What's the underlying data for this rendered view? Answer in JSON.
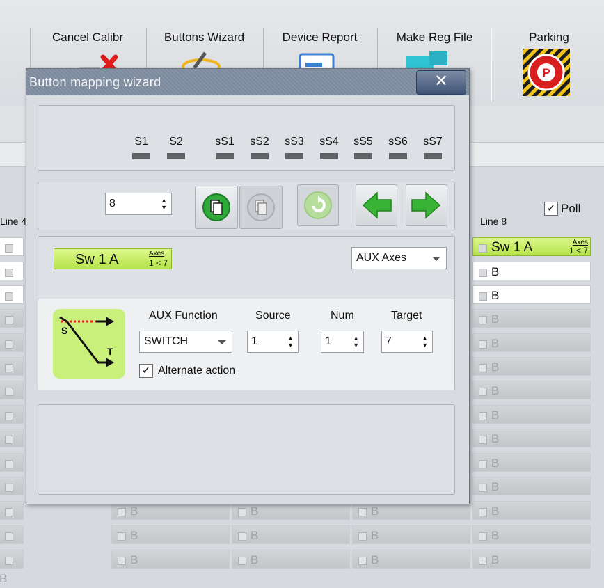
{
  "toolbar": {
    "buttons": [
      {
        "label": "Cancel Calibr",
        "icon": "cancel-calibration-icon"
      },
      {
        "label": "Buttons Wizard",
        "icon": "buttons-wizard-icon"
      },
      {
        "label": "Device Report",
        "icon": "device-report-icon"
      },
      {
        "label": "Make Reg File",
        "icon": "make-reg-file-icon"
      },
      {
        "label": "Parking",
        "icon": "parking-icon"
      }
    ]
  },
  "background": {
    "line4_label": "Line 4",
    "line8_label": "Line 8",
    "poll_label": "Poll",
    "poll_checked": true,
    "cell_text": "B",
    "line8_active_cell": {
      "name": "Sw 1 A",
      "tag_top": "Axes",
      "tag_bottom": "1 < 7"
    }
  },
  "dialog": {
    "title": "Button mapping wizard",
    "close_symbol": "✕",
    "indicators": [
      "S1",
      "S2",
      "sS1",
      "sS2",
      "sS3",
      "sS4",
      "sS5",
      "sS6",
      "sS7"
    ],
    "button_number": "8",
    "selected_button": {
      "name": "Sw 1 A",
      "tag_top": "Axes",
      "tag_bottom": "1 < 7"
    },
    "mode_select": "AUX Axes",
    "aux": {
      "function_header": "AUX Function",
      "source_header": "Source",
      "num_header": "Num",
      "target_header": "Target",
      "function_value": "SWITCH",
      "source_value": "1",
      "num_value": "1",
      "target_value": "7",
      "alternate_label": "Alternate action",
      "alternate_checked": true,
      "diagram_s": "S",
      "diagram_t": "T"
    }
  },
  "colors": {
    "accent_green": "#b6e34c",
    "arrow_green": "#39b335",
    "titlebar": "#8390a3"
  }
}
